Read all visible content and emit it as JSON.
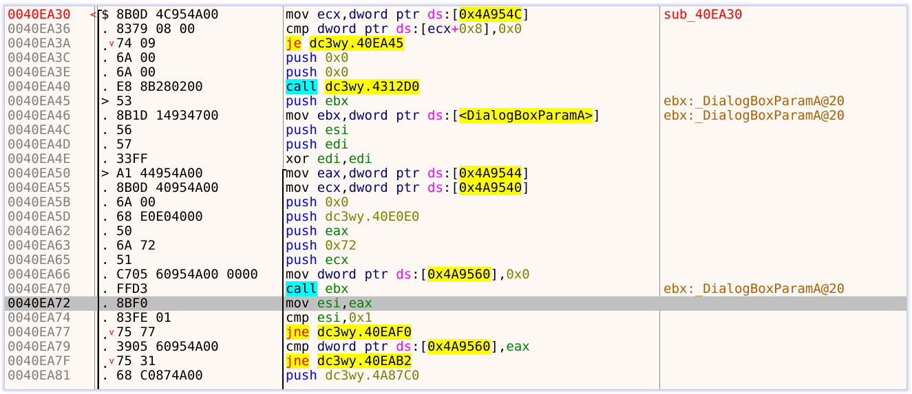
{
  "disassembly": {
    "function_label": "sub_40EA30",
    "selected_address": "0040EA72",
    "rows": [
      {
        "addr": "0040EA30",
        "mark": "<",
        "arrow": "$",
        "jmp": "",
        "bytes": "8B0D 4C954A00",
        "instr": [
          [
            "mov",
            "mn-std"
          ],
          [
            " ",
            "t"
          ],
          [
            "ecx",
            "op-reg-b"
          ],
          [
            ",",
            "op-txt"
          ],
          [
            "dword",
            "op-reg-b"
          ],
          [
            " ",
            "t"
          ],
          [
            "ptr",
            "op-reg-b"
          ],
          [
            " ",
            "t"
          ],
          [
            "ds",
            "op-seg"
          ],
          [
            ":[",
            "op-txt"
          ],
          [
            "0x4A954C",
            "op-mem"
          ],
          [
            "]",
            "op-txt"
          ]
        ],
        "comment": "sub_40EA30",
        "comment_kind": "fn"
      },
      {
        "addr": "0040EA36",
        "mark": "",
        "arrow": ".",
        "jmp": "",
        "bytes": "8379 08 00",
        "instr": [
          [
            "cmp",
            "mn-std"
          ],
          [
            " ",
            "t"
          ],
          [
            "dword",
            "op-reg-b"
          ],
          [
            " ",
            "t"
          ],
          [
            "ptr",
            "op-reg-b"
          ],
          [
            " ",
            "t"
          ],
          [
            "ds",
            "op-seg"
          ],
          [
            ":[",
            "op-txt"
          ],
          [
            "ecx",
            "op-reg-b"
          ],
          [
            "+",
            "op-seg"
          ],
          [
            "0x8",
            "op-imm"
          ],
          [
            "],",
            "op-txt"
          ],
          [
            "0x0",
            "op-imm"
          ]
        ],
        "comment": "",
        "comment_kind": ""
      },
      {
        "addr": "0040EA3A",
        "mark": "",
        "arrow": ".",
        "jmp": "v",
        "bytes": "74 09",
        "instr": [
          [
            "je",
            "mn-jcc"
          ],
          [
            " ",
            "t"
          ],
          [
            "dc3wy.40EA45",
            "op-jmp"
          ]
        ],
        "comment": "",
        "comment_kind": ""
      },
      {
        "addr": "0040EA3C",
        "mark": "",
        "arrow": ".",
        "jmp": "",
        "bytes": "6A 00",
        "instr": [
          [
            "push",
            "mn-push"
          ],
          [
            " ",
            "t"
          ],
          [
            "0x0",
            "op-imm"
          ]
        ],
        "comment": "",
        "comment_kind": ""
      },
      {
        "addr": "0040EA3E",
        "mark": "",
        "arrow": ".",
        "jmp": "",
        "bytes": "6A 00",
        "instr": [
          [
            "push",
            "mn-push"
          ],
          [
            " ",
            "t"
          ],
          [
            "0x0",
            "op-imm"
          ]
        ],
        "comment": "",
        "comment_kind": ""
      },
      {
        "addr": "0040EA40",
        "mark": "",
        "arrow": ".",
        "jmp": "",
        "bytes": "E8 8B280200",
        "instr": [
          [
            "call",
            "mn-call"
          ],
          [
            " ",
            "t"
          ],
          [
            "dc3wy.4312D0",
            "op-jmp"
          ]
        ],
        "comment": "",
        "comment_kind": ""
      },
      {
        "addr": "0040EA45",
        "mark": "",
        "arrow": ">",
        "jmp": "",
        "bytes": "53",
        "instr": [
          [
            "push",
            "mn-push"
          ],
          [
            " ",
            "t"
          ],
          [
            "ebx",
            "op-reg"
          ]
        ],
        "comment": "ebx:_DialogBoxParamA@20",
        "comment_kind": "api"
      },
      {
        "addr": "0040EA46",
        "mark": "",
        "arrow": ".",
        "jmp": "",
        "bytes": "8B1D 14934700",
        "instr": [
          [
            "mov",
            "mn-std"
          ],
          [
            " ",
            "t"
          ],
          [
            "ebx",
            "op-reg-b"
          ],
          [
            ",",
            "op-txt"
          ],
          [
            "dword",
            "op-reg-b"
          ],
          [
            " ",
            "t"
          ],
          [
            "ptr",
            "op-reg-b"
          ],
          [
            " ",
            "t"
          ],
          [
            "ds",
            "op-seg"
          ],
          [
            ":[",
            "op-txt"
          ],
          [
            "<DialogBoxParamA>",
            "op-mem"
          ],
          [
            "]",
            "op-txt"
          ]
        ],
        "comment": "ebx:_DialogBoxParamA@20",
        "comment_kind": "api"
      },
      {
        "addr": "0040EA4C",
        "mark": "",
        "arrow": ".",
        "jmp": "",
        "bytes": "56",
        "instr": [
          [
            "push",
            "mn-push"
          ],
          [
            " ",
            "t"
          ],
          [
            "esi",
            "op-reg"
          ]
        ],
        "comment": "",
        "comment_kind": ""
      },
      {
        "addr": "0040EA4D",
        "mark": "",
        "arrow": ".",
        "jmp": "",
        "bytes": "57",
        "instr": [
          [
            "push",
            "mn-push"
          ],
          [
            " ",
            "t"
          ],
          [
            "edi",
            "op-reg"
          ]
        ],
        "comment": "",
        "comment_kind": ""
      },
      {
        "addr": "0040EA4E",
        "mark": "",
        "arrow": ".",
        "jmp": "",
        "bytes": "33FF",
        "instr": [
          [
            "xor",
            "mn-std"
          ],
          [
            " ",
            "t"
          ],
          [
            "edi",
            "op-reg"
          ],
          [
            ",",
            "op-txt"
          ],
          [
            "edi",
            "op-reg"
          ]
        ],
        "comment": "",
        "comment_kind": ""
      },
      {
        "addr": "0040EA50",
        "mark": "",
        "arrow": ">",
        "jmp": "",
        "bytes": "A1 44954A00",
        "instr": [
          [
            "mov",
            "mn-std"
          ],
          [
            " ",
            "t"
          ],
          [
            "eax",
            "op-reg-b"
          ],
          [
            ",",
            "op-txt"
          ],
          [
            "dword",
            "op-reg-b"
          ],
          [
            " ",
            "t"
          ],
          [
            "ptr",
            "op-reg-b"
          ],
          [
            " ",
            "t"
          ],
          [
            "ds",
            "op-seg"
          ],
          [
            ":[",
            "op-txt"
          ],
          [
            "0x4A9544",
            "op-mem"
          ],
          [
            "]",
            "op-txt"
          ]
        ],
        "comment": "",
        "comment_kind": ""
      },
      {
        "addr": "0040EA55",
        "mark": "",
        "arrow": ".",
        "jmp": "",
        "bytes": "8B0D 40954A00",
        "instr": [
          [
            "mov",
            "mn-std"
          ],
          [
            " ",
            "t"
          ],
          [
            "ecx",
            "op-reg-b"
          ],
          [
            ",",
            "op-txt"
          ],
          [
            "dword",
            "op-reg-b"
          ],
          [
            " ",
            "t"
          ],
          [
            "ptr",
            "op-reg-b"
          ],
          [
            " ",
            "t"
          ],
          [
            "ds",
            "op-seg"
          ],
          [
            ":[",
            "op-txt"
          ],
          [
            "0x4A9540",
            "op-mem"
          ],
          [
            "]",
            "op-txt"
          ]
        ],
        "comment": "",
        "comment_kind": ""
      },
      {
        "addr": "0040EA5B",
        "mark": "",
        "arrow": ".",
        "jmp": "",
        "bytes": "6A 00",
        "instr": [
          [
            "push",
            "mn-push"
          ],
          [
            " ",
            "t"
          ],
          [
            "0x0",
            "op-imm"
          ]
        ],
        "comment": "",
        "comment_kind": ""
      },
      {
        "addr": "0040EA5D",
        "mark": "",
        "arrow": ".",
        "jmp": "",
        "bytes": "68 E0E04000",
        "instr": [
          [
            "push",
            "mn-push"
          ],
          [
            " ",
            "t"
          ],
          [
            "dc3wy.40E0E0",
            "op-imm"
          ]
        ],
        "comment": "",
        "comment_kind": ""
      },
      {
        "addr": "0040EA62",
        "mark": "",
        "arrow": ".",
        "jmp": "",
        "bytes": "50",
        "instr": [
          [
            "push",
            "mn-push"
          ],
          [
            " ",
            "t"
          ],
          [
            "eax",
            "op-reg"
          ]
        ],
        "comment": "",
        "comment_kind": ""
      },
      {
        "addr": "0040EA63",
        "mark": "",
        "arrow": ".",
        "jmp": "",
        "bytes": "6A 72",
        "instr": [
          [
            "push",
            "mn-push"
          ],
          [
            " ",
            "t"
          ],
          [
            "0x72",
            "op-imm"
          ]
        ],
        "comment": "",
        "comment_kind": ""
      },
      {
        "addr": "0040EA65",
        "mark": "",
        "arrow": ".",
        "jmp": "",
        "bytes": "51",
        "instr": [
          [
            "push",
            "mn-push"
          ],
          [
            " ",
            "t"
          ],
          [
            "ecx",
            "op-reg"
          ]
        ],
        "comment": "",
        "comment_kind": ""
      },
      {
        "addr": "0040EA66",
        "mark": "",
        "arrow": ".",
        "jmp": "",
        "bytes": "C705 60954A00 0000",
        "instr": [
          [
            "mov",
            "mn-std"
          ],
          [
            " ",
            "t"
          ],
          [
            "dword",
            "op-reg-b"
          ],
          [
            " ",
            "t"
          ],
          [
            "ptr",
            "op-reg-b"
          ],
          [
            " ",
            "t"
          ],
          [
            "ds",
            "op-seg"
          ],
          [
            ":[",
            "op-txt"
          ],
          [
            "0x4A9560",
            "op-mem"
          ],
          [
            "],",
            "op-txt"
          ],
          [
            "0x0",
            "op-imm"
          ]
        ],
        "comment": "",
        "comment_kind": ""
      },
      {
        "addr": "0040EA70",
        "mark": "",
        "arrow": ".",
        "jmp": "",
        "bytes": "FFD3",
        "instr": [
          [
            "call",
            "mn-call"
          ],
          [
            " ",
            "t"
          ],
          [
            "ebx",
            "op-reg"
          ]
        ],
        "comment": "ebx:_DialogBoxParamA@20",
        "comment_kind": "api"
      },
      {
        "addr": "0040EA72",
        "mark": "",
        "arrow": ".",
        "jmp": "",
        "bytes": "8BF0",
        "instr": [
          [
            "mov",
            "mn-std"
          ],
          [
            " ",
            "t"
          ],
          [
            "esi",
            "op-reg"
          ],
          [
            ",",
            "op-txt"
          ],
          [
            "eax",
            "op-reg"
          ]
        ],
        "comment": "",
        "comment_kind": ""
      },
      {
        "addr": "0040EA74",
        "mark": "",
        "arrow": ".",
        "jmp": "",
        "bytes": "83FE 01",
        "instr": [
          [
            "cmp",
            "mn-std"
          ],
          [
            " ",
            "t"
          ],
          [
            "esi",
            "op-reg"
          ],
          [
            ",",
            "op-txt"
          ],
          [
            "0x1",
            "op-imm"
          ]
        ],
        "comment": "",
        "comment_kind": ""
      },
      {
        "addr": "0040EA77",
        "mark": "",
        "arrow": ".",
        "jmp": "v",
        "bytes": "75 77",
        "instr": [
          [
            "jne",
            "mn-jcc"
          ],
          [
            " ",
            "t"
          ],
          [
            "dc3wy.40EAF0",
            "op-jmp"
          ]
        ],
        "comment": "",
        "comment_kind": ""
      },
      {
        "addr": "0040EA79",
        "mark": "",
        "arrow": ".",
        "jmp": "",
        "bytes": "3905 60954A00",
        "instr": [
          [
            "cmp",
            "mn-std"
          ],
          [
            " ",
            "t"
          ],
          [
            "dword",
            "op-reg-b"
          ],
          [
            " ",
            "t"
          ],
          [
            "ptr",
            "op-reg-b"
          ],
          [
            " ",
            "t"
          ],
          [
            "ds",
            "op-seg"
          ],
          [
            ":[",
            "op-txt"
          ],
          [
            "0x4A9560",
            "op-mem"
          ],
          [
            "],",
            "op-txt"
          ],
          [
            "eax",
            "op-reg"
          ]
        ],
        "comment": "",
        "comment_kind": ""
      },
      {
        "addr": "0040EA7F",
        "mark": "",
        "arrow": ".",
        "jmp": "v",
        "bytes": "75 31",
        "instr": [
          [
            "jne",
            "mn-jcc"
          ],
          [
            " ",
            "t"
          ],
          [
            "dc3wy.40EAB2",
            "op-jmp"
          ]
        ],
        "comment": "",
        "comment_kind": ""
      },
      {
        "addr": "0040EA81",
        "mark": "",
        "arrow": ".",
        "jmp": "",
        "bytes": "68 C0874A00",
        "instr": [
          [
            "push",
            "mn-push"
          ],
          [
            " ",
            "t"
          ],
          [
            "dc3wy.4A87C0",
            "op-imm"
          ]
        ],
        "comment": "",
        "comment_kind": ""
      }
    ]
  }
}
